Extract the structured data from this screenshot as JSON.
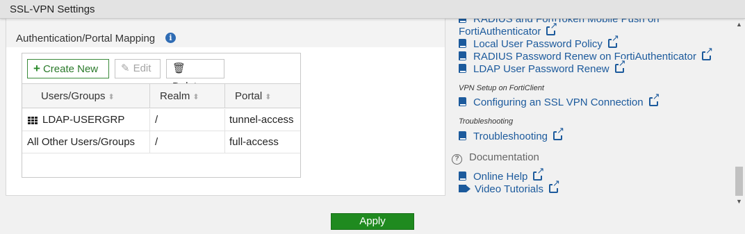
{
  "window": {
    "title": "SSL-VPN Settings"
  },
  "panel": {
    "title": "Authentication/Portal Mapping",
    "toolbar": {
      "create_label": "Create New",
      "edit_label": "Edit",
      "delete_label": "Delete"
    },
    "columns": [
      "Users/Groups",
      "Realm",
      "Portal"
    ],
    "rows": [
      {
        "users": "LDAP-USERGRP",
        "realm": "/",
        "portal": "tunnel-access"
      },
      {
        "users": "All Other Users/Groups",
        "realm": "/",
        "portal": "full-access"
      }
    ]
  },
  "help": {
    "links_top": [
      {
        "line1": "RADIUS and FortiToken Mobile Push on",
        "line2": "FortiAuthenticator"
      },
      {
        "label": "Local User Password Policy"
      },
      {
        "label": "RADIUS Password Renew on FortiAuthenticator"
      },
      {
        "label": "LDAP User Password Renew"
      }
    ],
    "vpn_setup_heading": "VPN Setup on FortiClient",
    "vpn_setup_link": "Configuring an SSL VPN Connection",
    "troubleshooting_heading": "Troubleshooting",
    "troubleshooting_link": "Troubleshooting",
    "documentation_heading": "Documentation",
    "doc_links": [
      "Online Help",
      "Video Tutorials"
    ]
  },
  "footer": {
    "apply_label": "Apply"
  },
  "colors": {
    "link": "#1c5a9c",
    "apply": "#1f8a1f",
    "create": "#2a7a2a"
  },
  "icons": [
    "info-icon",
    "plus-icon",
    "pencil-icon",
    "trash-icon",
    "sort-icon",
    "group-icon",
    "book-icon",
    "external-link-icon",
    "question-icon",
    "video-icon"
  ]
}
